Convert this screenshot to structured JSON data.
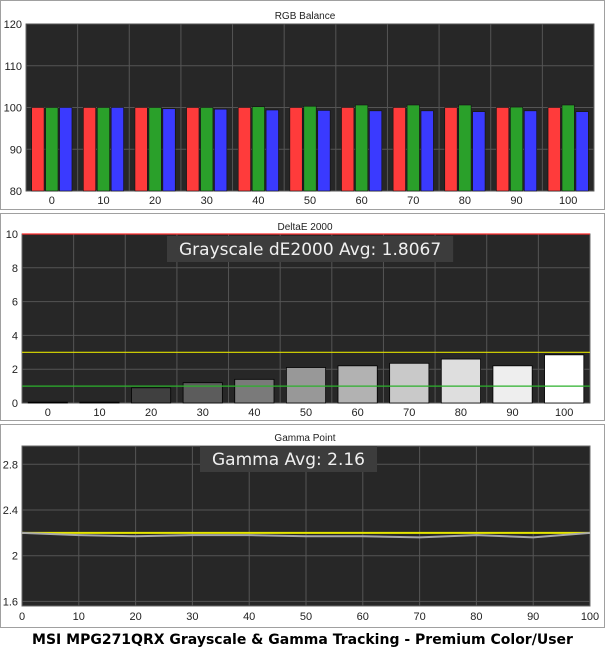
{
  "chart_data": [
    {
      "type": "bar",
      "title": "RGB Balance",
      "categories": [
        "0",
        "10",
        "20",
        "30",
        "40",
        "50",
        "60",
        "70",
        "80",
        "90",
        "100"
      ],
      "series": [
        {
          "color": "#ff3b3b",
          "values": [
            100,
            100,
            100,
            100,
            100,
            100,
            100,
            100,
            100,
            100,
            100
          ]
        },
        {
          "color": "#2aa02a",
          "values": [
            100,
            100,
            100,
            100,
            100.2,
            100.3,
            100.6,
            100.6,
            100.6,
            100.1,
            100.6
          ]
        },
        {
          "color": "#3a3aff",
          "values": [
            100,
            100,
            99.7,
            99.6,
            99.4,
            99.3,
            99.2,
            99.2,
            99,
            99.2,
            99
          ]
        }
      ],
      "yticks": [
        80,
        90,
        100,
        110,
        120
      ],
      "ylim": [
        80,
        120
      ],
      "grid": true
    },
    {
      "type": "bar",
      "title": "DeltaE 2000",
      "annotation": "Grayscale dE2000 Avg: 1.8067",
      "categories": [
        "0",
        "10",
        "20",
        "30",
        "40",
        "50",
        "60",
        "70",
        "80",
        "90",
        "100"
      ],
      "values": [
        0.05,
        0.05,
        0.9,
        1.2,
        1.4,
        2.1,
        2.2,
        2.35,
        2.6,
        2.2,
        2.85
      ],
      "bar_shades": [
        "#151515",
        "#2a2a2a",
        "#404040",
        "#5c5c5c",
        "#7a7a7a",
        "#989898",
        "#b2b2b2",
        "#c9c9c9",
        "#dedede",
        "#eeeeee",
        "#ffffff"
      ],
      "yticks": [
        0,
        2,
        4,
        6,
        8,
        10
      ],
      "ylim": [
        0,
        10
      ],
      "reference_lines": [
        {
          "value": 10,
          "color": "#ff3030"
        },
        {
          "value": 3,
          "color": "#e0e000"
        },
        {
          "value": 1,
          "color": "#2cb02c"
        }
      ],
      "grid": true
    },
    {
      "type": "line",
      "title": "Gamma Point",
      "annotation": "Gamma Avg: 2.16",
      "x": [
        0,
        10,
        20,
        30,
        40,
        50,
        60,
        70,
        80,
        90,
        100
      ],
      "xticks": [
        0,
        10,
        20,
        30,
        40,
        50,
        60,
        70,
        80,
        90,
        100
      ],
      "series": [
        {
          "color": "#a8a8a8",
          "values": [
            2.2,
            2.18,
            2.17,
            2.18,
            2.18,
            2.17,
            2.17,
            2.16,
            2.18,
            2.16,
            2.2
          ]
        }
      ],
      "target": {
        "value": 2.2,
        "color": "#e6e600"
      },
      "yticks": [
        1.6,
        2,
        2.4,
        2.8
      ],
      "ylim": [
        1.56,
        2.96
      ],
      "xlim": [
        0,
        100
      ],
      "grid": true
    }
  ],
  "caption": "MSI MPG271QRX Grayscale & Gamma Tracking - Premium Color/User",
  "colors": {
    "background": "#ffffff",
    "plot_background": "#272727",
    "grid": "#555555",
    "frame": "#6a6a6a",
    "text": "#222222",
    "annotation_box": "#3c3c3c",
    "annotation_text": "#f0f0f0"
  }
}
